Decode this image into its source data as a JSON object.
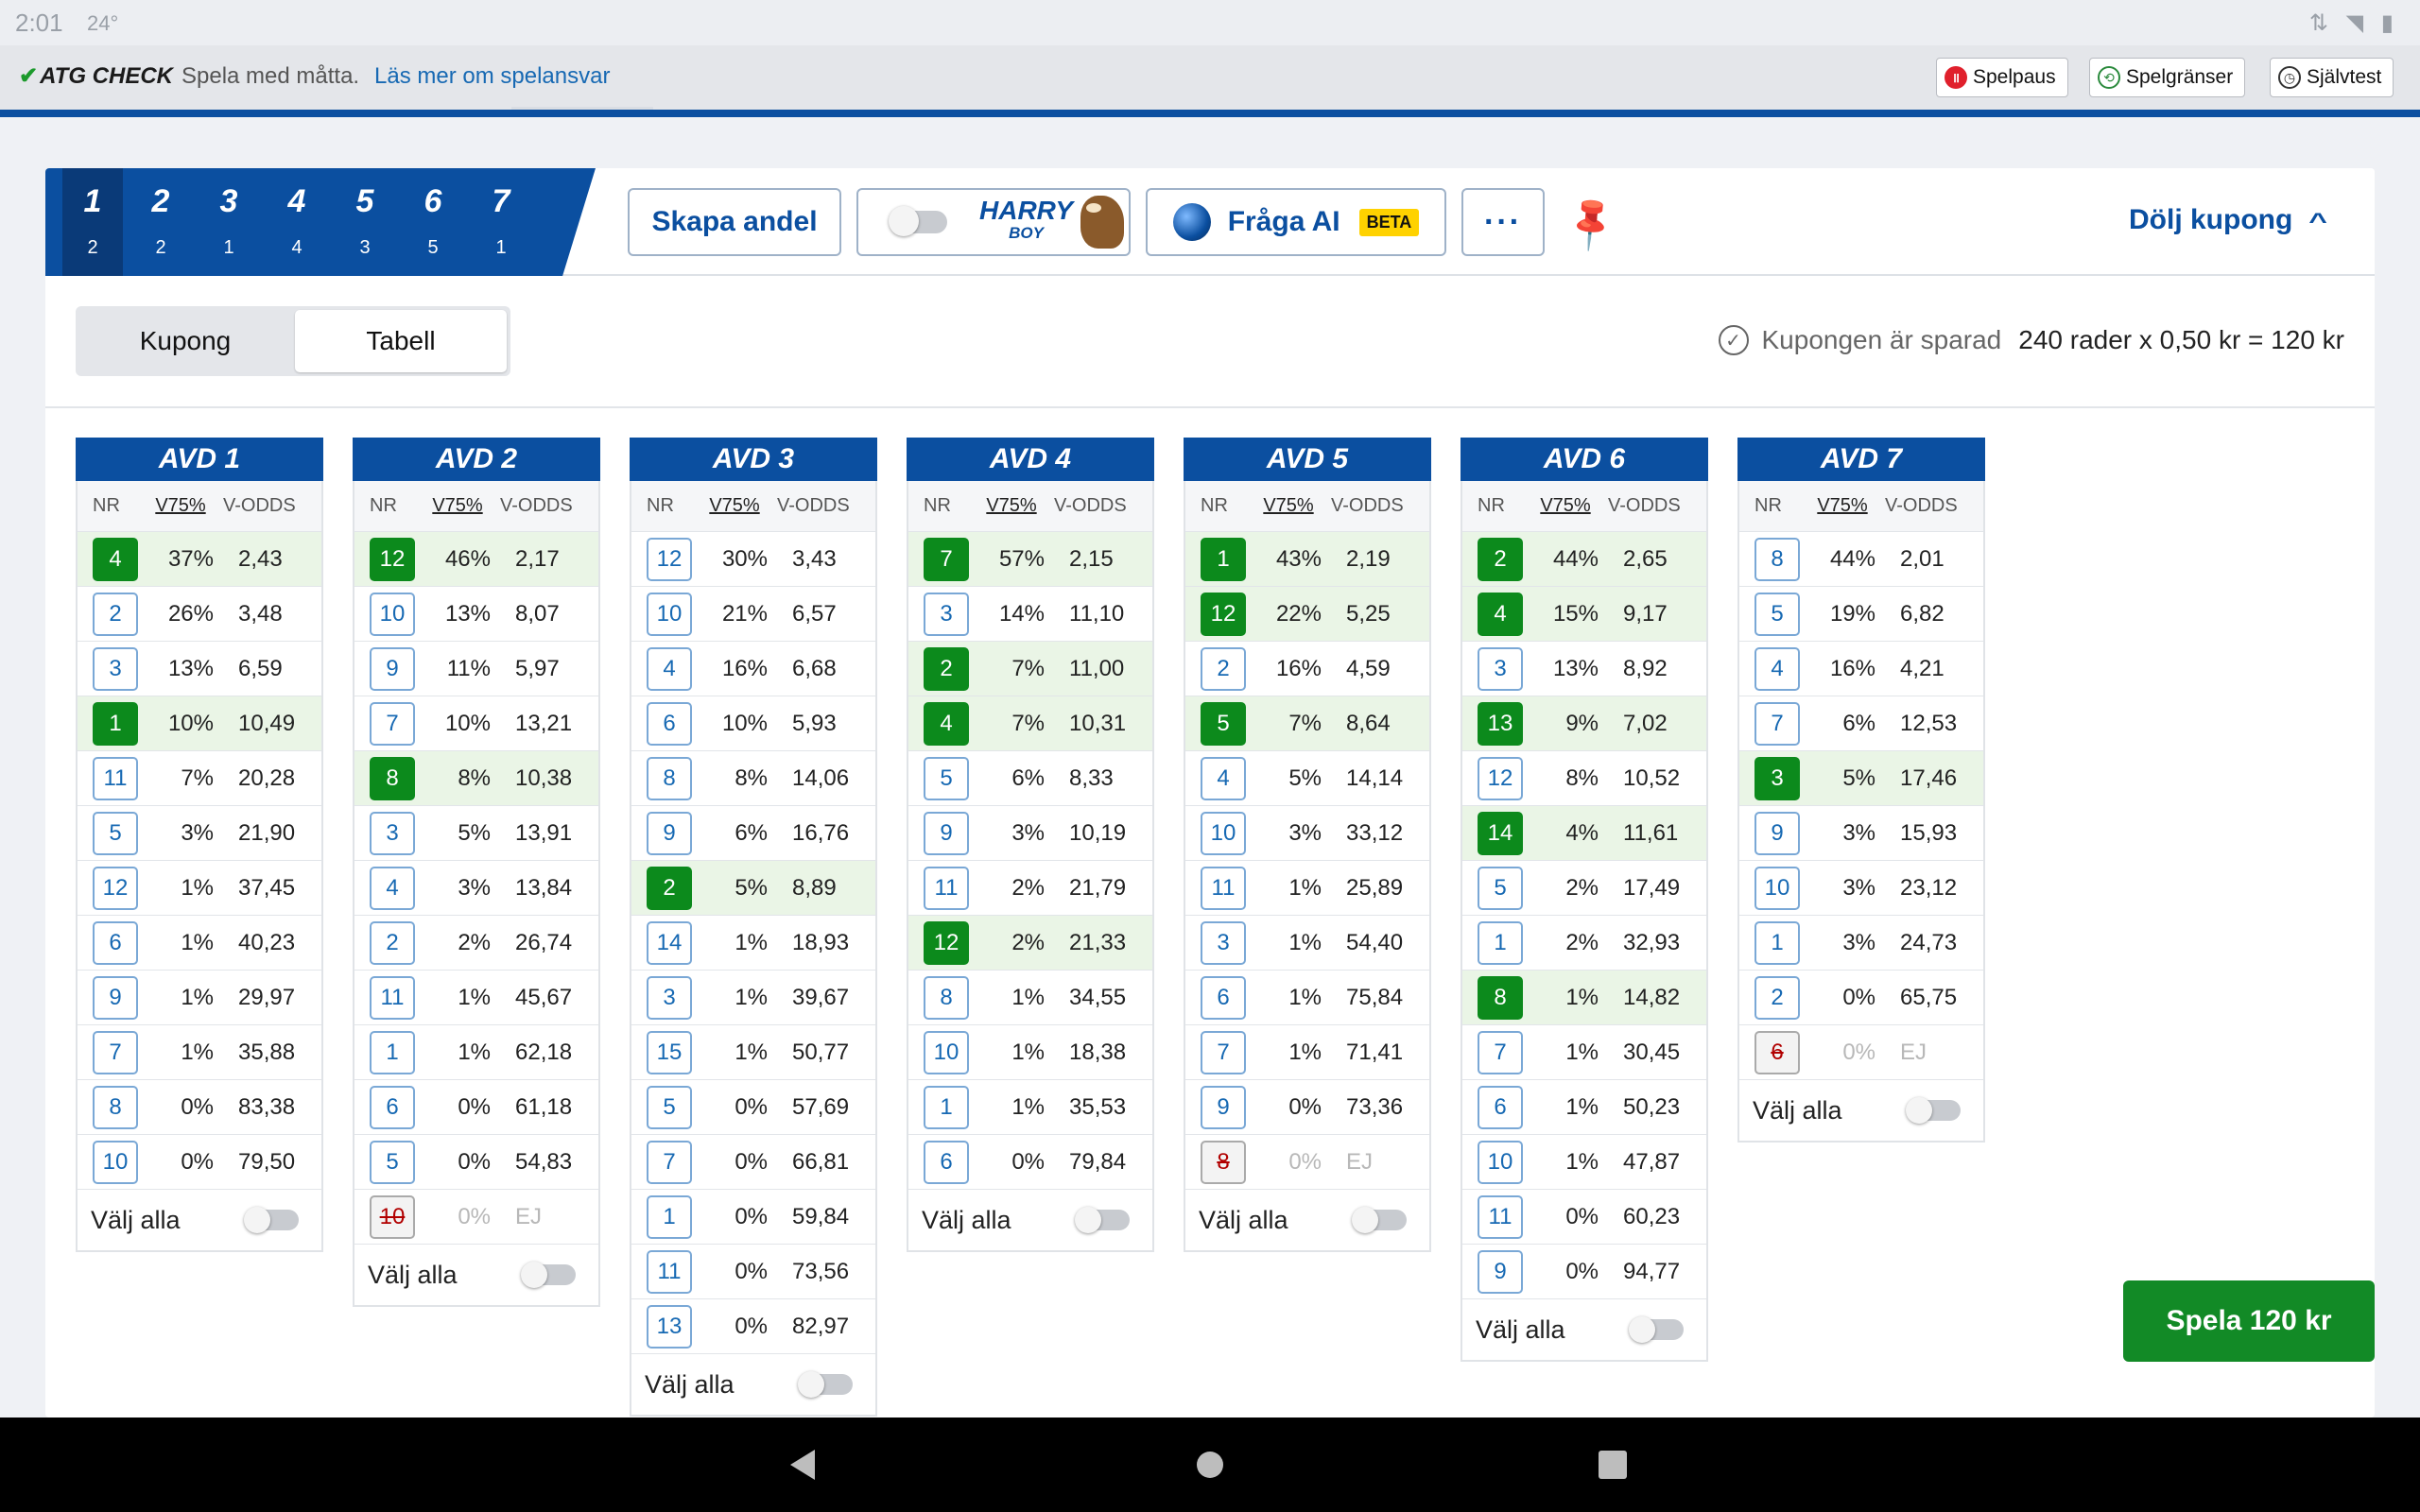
{
  "status": {
    "time": "2:01",
    "temp": "24°",
    "icons": "wifi-icon battery-icon"
  },
  "check_bar": {
    "brand": "ATG CHECK",
    "message": "Spela med måtta.",
    "link": "Läs mer om spelansvar",
    "buttons": [
      "Spelpaus",
      "Spelgränser",
      "Självtest"
    ]
  },
  "race_tabs": [
    {
      "num": "1",
      "sub": "2"
    },
    {
      "num": "2",
      "sub": "2"
    },
    {
      "num": "3",
      "sub": "1"
    },
    {
      "num": "4",
      "sub": "4"
    },
    {
      "num": "5",
      "sub": "3"
    },
    {
      "num": "6",
      "sub": "5"
    },
    {
      "num": "7",
      "sub": "1"
    }
  ],
  "toolbar": {
    "share": "Skapa andel",
    "harry_top": "HARRY",
    "harry_bottom": "BOY",
    "ai": "Fråga AI",
    "beta": "BETA",
    "more": "···",
    "hide": "Dölj kupong"
  },
  "view_toggle": {
    "coupon": "Kupong",
    "table": "Tabell"
  },
  "summary": {
    "saved": "Kupongen är sparad",
    "cost": "240 rader x 0,50 kr = 120 kr"
  },
  "columns": {
    "nr": "NR",
    "pct": "V75%",
    "odds": "V-ODDS"
  },
  "select_all": "Välj alla",
  "play_button": "Spela 120 kr",
  "colors": {
    "primary": "#0b4fa0",
    "selected": "#0c8a1c",
    "play": "#128a26"
  },
  "avds": [
    {
      "title": "AVD 1",
      "rows": [
        {
          "nr": "4",
          "pct": "37%",
          "odds": "2,43",
          "sel": true
        },
        {
          "nr": "2",
          "pct": "26%",
          "odds": "3,48"
        },
        {
          "nr": "3",
          "pct": "13%",
          "odds": "6,59"
        },
        {
          "nr": "1",
          "pct": "10%",
          "odds": "10,49",
          "sel": true
        },
        {
          "nr": "11",
          "pct": "7%",
          "odds": "20,28"
        },
        {
          "nr": "5",
          "pct": "3%",
          "odds": "21,90"
        },
        {
          "nr": "12",
          "pct": "1%",
          "odds": "37,45"
        },
        {
          "nr": "6",
          "pct": "1%",
          "odds": "40,23"
        },
        {
          "nr": "9",
          "pct": "1%",
          "odds": "29,97"
        },
        {
          "nr": "7",
          "pct": "1%",
          "odds": "35,88"
        },
        {
          "nr": "8",
          "pct": "0%",
          "odds": "83,38"
        },
        {
          "nr": "10",
          "pct": "0%",
          "odds": "79,50"
        }
      ]
    },
    {
      "title": "AVD 2",
      "rows": [
        {
          "nr": "12",
          "pct": "46%",
          "odds": "2,17",
          "sel": true
        },
        {
          "nr": "10",
          "pct": "13%",
          "odds": "8,07"
        },
        {
          "nr": "9",
          "pct": "11%",
          "odds": "5,97"
        },
        {
          "nr": "7",
          "pct": "10%",
          "odds": "13,21"
        },
        {
          "nr": "8",
          "pct": "8%",
          "odds": "10,38",
          "sel": true
        },
        {
          "nr": "3",
          "pct": "5%",
          "odds": "13,91"
        },
        {
          "nr": "4",
          "pct": "3%",
          "odds": "13,84"
        },
        {
          "nr": "2",
          "pct": "2%",
          "odds": "26,74"
        },
        {
          "nr": "11",
          "pct": "1%",
          "odds": "45,67"
        },
        {
          "nr": "1",
          "pct": "1%",
          "odds": "62,18"
        },
        {
          "nr": "6",
          "pct": "0%",
          "odds": "61,18"
        },
        {
          "nr": "5",
          "pct": "0%",
          "odds": "54,83"
        },
        {
          "nr": "10",
          "pct": "0%",
          "odds": "EJ",
          "scr": true
        }
      ]
    },
    {
      "title": "AVD 3",
      "rows": [
        {
          "nr": "12",
          "pct": "30%",
          "odds": "3,43"
        },
        {
          "nr": "10",
          "pct": "21%",
          "odds": "6,57"
        },
        {
          "nr": "4",
          "pct": "16%",
          "odds": "6,68"
        },
        {
          "nr": "6",
          "pct": "10%",
          "odds": "5,93"
        },
        {
          "nr": "8",
          "pct": "8%",
          "odds": "14,06"
        },
        {
          "nr": "9",
          "pct": "6%",
          "odds": "16,76"
        },
        {
          "nr": "2",
          "pct": "5%",
          "odds": "8,89",
          "sel": true
        },
        {
          "nr": "14",
          "pct": "1%",
          "odds": "18,93"
        },
        {
          "nr": "3",
          "pct": "1%",
          "odds": "39,67"
        },
        {
          "nr": "15",
          "pct": "1%",
          "odds": "50,77"
        },
        {
          "nr": "5",
          "pct": "0%",
          "odds": "57,69"
        },
        {
          "nr": "7",
          "pct": "0%",
          "odds": "66,81"
        },
        {
          "nr": "1",
          "pct": "0%",
          "odds": "59,84"
        },
        {
          "nr": "11",
          "pct": "0%",
          "odds": "73,56"
        },
        {
          "nr": "13",
          "pct": "0%",
          "odds": "82,97"
        }
      ]
    },
    {
      "title": "AVD 4",
      "rows": [
        {
          "nr": "7",
          "pct": "57%",
          "odds": "2,15",
          "sel": true
        },
        {
          "nr": "3",
          "pct": "14%",
          "odds": "11,10"
        },
        {
          "nr": "2",
          "pct": "7%",
          "odds": "11,00",
          "sel": true
        },
        {
          "nr": "4",
          "pct": "7%",
          "odds": "10,31",
          "sel": true
        },
        {
          "nr": "5",
          "pct": "6%",
          "odds": "8,33"
        },
        {
          "nr": "9",
          "pct": "3%",
          "odds": "10,19"
        },
        {
          "nr": "11",
          "pct": "2%",
          "odds": "21,79"
        },
        {
          "nr": "12",
          "pct": "2%",
          "odds": "21,33",
          "sel": true
        },
        {
          "nr": "8",
          "pct": "1%",
          "odds": "34,55"
        },
        {
          "nr": "10",
          "pct": "1%",
          "odds": "18,38"
        },
        {
          "nr": "1",
          "pct": "1%",
          "odds": "35,53"
        },
        {
          "nr": "6",
          "pct": "0%",
          "odds": "79,84"
        }
      ]
    },
    {
      "title": "AVD 5",
      "rows": [
        {
          "nr": "1",
          "pct": "43%",
          "odds": "2,19",
          "sel": true
        },
        {
          "nr": "12",
          "pct": "22%",
          "odds": "5,25",
          "sel": true
        },
        {
          "nr": "2",
          "pct": "16%",
          "odds": "4,59"
        },
        {
          "nr": "5",
          "pct": "7%",
          "odds": "8,64",
          "sel": true
        },
        {
          "nr": "4",
          "pct": "5%",
          "odds": "14,14"
        },
        {
          "nr": "10",
          "pct": "3%",
          "odds": "33,12"
        },
        {
          "nr": "11",
          "pct": "1%",
          "odds": "25,89"
        },
        {
          "nr": "3",
          "pct": "1%",
          "odds": "54,40"
        },
        {
          "nr": "6",
          "pct": "1%",
          "odds": "75,84"
        },
        {
          "nr": "7",
          "pct": "1%",
          "odds": "71,41"
        },
        {
          "nr": "9",
          "pct": "0%",
          "odds": "73,36"
        },
        {
          "nr": "8",
          "pct": "0%",
          "odds": "EJ",
          "scr": true
        }
      ]
    },
    {
      "title": "AVD 6",
      "rows": [
        {
          "nr": "2",
          "pct": "44%",
          "odds": "2,65",
          "sel": true
        },
        {
          "nr": "4",
          "pct": "15%",
          "odds": "9,17",
          "sel": true
        },
        {
          "nr": "3",
          "pct": "13%",
          "odds": "8,92"
        },
        {
          "nr": "13",
          "pct": "9%",
          "odds": "7,02",
          "sel": true
        },
        {
          "nr": "12",
          "pct": "8%",
          "odds": "10,52"
        },
        {
          "nr": "14",
          "pct": "4%",
          "odds": "11,61",
          "sel": true
        },
        {
          "nr": "5",
          "pct": "2%",
          "odds": "17,49"
        },
        {
          "nr": "1",
          "pct": "2%",
          "odds": "32,93"
        },
        {
          "nr": "8",
          "pct": "1%",
          "odds": "14,82",
          "sel": true
        },
        {
          "nr": "7",
          "pct": "1%",
          "odds": "30,45"
        },
        {
          "nr": "6",
          "pct": "1%",
          "odds": "50,23"
        },
        {
          "nr": "10",
          "pct": "1%",
          "odds": "47,87"
        },
        {
          "nr": "11",
          "pct": "0%",
          "odds": "60,23"
        },
        {
          "nr": "9",
          "pct": "0%",
          "odds": "94,77"
        }
      ]
    },
    {
      "title": "AVD 7",
      "rows": [
        {
          "nr": "8",
          "pct": "44%",
          "odds": "2,01"
        },
        {
          "nr": "5",
          "pct": "19%",
          "odds": "6,82"
        },
        {
          "nr": "4",
          "pct": "16%",
          "odds": "4,21"
        },
        {
          "nr": "7",
          "pct": "6%",
          "odds": "12,53"
        },
        {
          "nr": "3",
          "pct": "5%",
          "odds": "17,46",
          "sel": true
        },
        {
          "nr": "9",
          "pct": "3%",
          "odds": "15,93"
        },
        {
          "nr": "10",
          "pct": "3%",
          "odds": "23,12"
        },
        {
          "nr": "1",
          "pct": "3%",
          "odds": "24,73"
        },
        {
          "nr": "2",
          "pct": "0%",
          "odds": "65,75"
        },
        {
          "nr": "6",
          "pct": "0%",
          "odds": "EJ",
          "scr": true
        }
      ]
    }
  ]
}
